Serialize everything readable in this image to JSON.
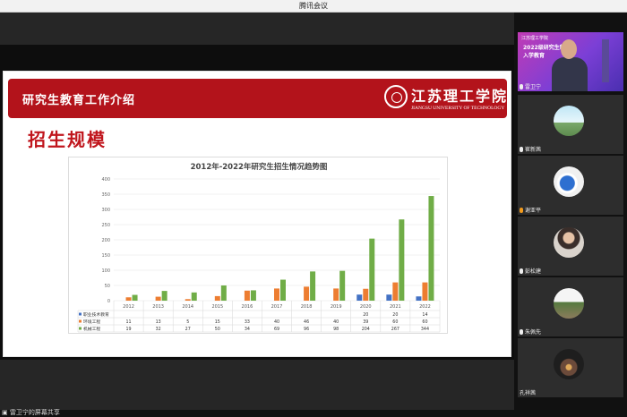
{
  "window": {
    "title": "腾讯会议"
  },
  "slide": {
    "banner_title": "研究生教育工作介绍",
    "logo_cn": "江苏理工学院",
    "logo_en": "JIANGSU UNIVERSITY OF TECHNOLOGY",
    "section_title": "招生规模"
  },
  "chart_data": {
    "type": "bar",
    "title": "2012年-2022年研究生招生情况趋势图",
    "categories": [
      "2012",
      "2013",
      "2014",
      "2015",
      "2016",
      "2017",
      "2018",
      "2019",
      "2020",
      "2021",
      "2022"
    ],
    "ylim": [
      0,
      400
    ],
    "yticks": [
      0,
      50,
      100,
      150,
      200,
      250,
      300,
      350,
      400
    ],
    "grid": true,
    "legend": "table-below",
    "series": [
      {
        "name": "职业技术教育",
        "color": "#4472c4",
        "values": [
          null,
          null,
          null,
          null,
          null,
          null,
          null,
          null,
          20,
          20,
          14
        ]
      },
      {
        "name": "环境工程",
        "color": "#ed7d31",
        "values": [
          11,
          13,
          5,
          15,
          33,
          40,
          46,
          40,
          39,
          60,
          60
        ]
      },
      {
        "name": "机械工程",
        "color": "#70ad47",
        "values": [
          19,
          32,
          27,
          50,
          34,
          69,
          96,
          98,
          204,
          267,
          344
        ]
      }
    ]
  },
  "participants": {
    "tile1": {
      "badge": "江苏理工学院",
      "line1": "2022级研究生新生",
      "line2": "入学教育",
      "name": "雷卫宁"
    },
    "tile2": {
      "name": "崔新茜"
    },
    "tile3": {
      "name": "谢亚平"
    },
    "tile4": {
      "name": "彭松建"
    },
    "tile5": {
      "name": "朱佩先"
    },
    "tile6": {
      "name": "孔祥茜"
    }
  },
  "status": {
    "sharing": "雷卫宁的屏幕共享"
  },
  "colors": {
    "banner": "#b3131b",
    "section_title": "#c0151c"
  }
}
